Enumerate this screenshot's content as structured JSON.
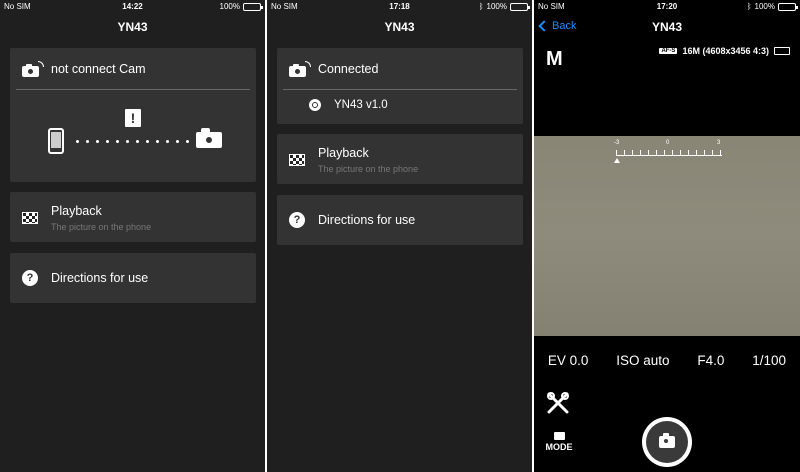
{
  "screens": [
    {
      "status": {
        "carrier": "No SIM",
        "time": "14:22",
        "battery": "100%"
      },
      "title": "YN43",
      "connection": {
        "label": "not connect Cam"
      },
      "menu": [
        {
          "label": "Playback",
          "sublabel": "The picture on the phone"
        },
        {
          "label": "Directions for use"
        }
      ]
    },
    {
      "status": {
        "carrier": "No SIM",
        "time": "17:18",
        "battery": "100%"
      },
      "title": "YN43",
      "connection": {
        "label": "Connected",
        "device": "YN43 v1.0"
      },
      "menu": [
        {
          "label": "Playback",
          "sublabel": "The picture on the phone"
        },
        {
          "label": "Directions for use"
        }
      ]
    },
    {
      "status": {
        "carrier": "No SIM",
        "time": "17:20",
        "battery": "100%"
      },
      "title": "YN43",
      "back_label": "Back",
      "mode": "M",
      "af_badge": "AF-S",
      "resolution": "16M (4608x3456 4:3)",
      "exposure_scale": [
        "-3",
        "0",
        "3"
      ],
      "params": {
        "ev": "EV 0.0",
        "iso": "ISO auto",
        "aperture": "F4.0",
        "shutter": "1/100"
      },
      "mode_button": "MODE"
    }
  ],
  "icons": {
    "camera_wifi": "camera-wifi-icon",
    "playback": "checkerboard-icon",
    "help": "question-icon",
    "phone": "phone-icon",
    "warning": "exclamation-icon",
    "camera": "camera-icon",
    "bluetooth": "bluetooth-icon",
    "battery": "battery-icon",
    "wrench": "wrench-icon"
  },
  "colors": {
    "accent": "#1a8cff",
    "card": "#333333",
    "background": "#1f1f1f",
    "battery_green": "#3ad23a"
  }
}
